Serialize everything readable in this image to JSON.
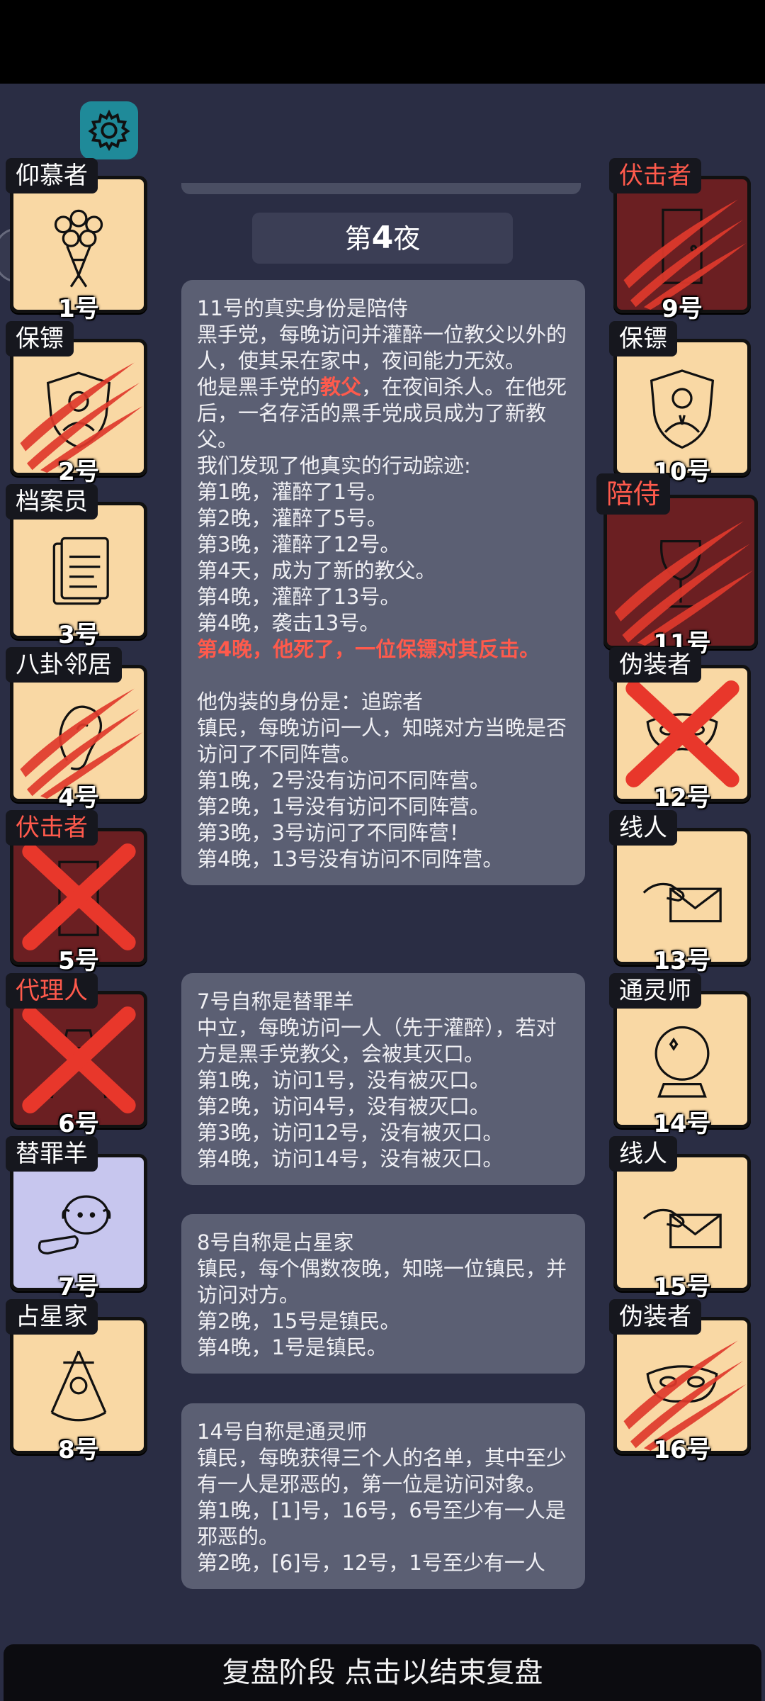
{
  "header": {
    "night_prefix": "第",
    "night_num": "4",
    "night_suffix": "夜"
  },
  "footer": {
    "text": "复盘阶段 点击以结束复盘"
  },
  "left_cards": [
    {
      "role": "仰慕者",
      "num": "1号",
      "state": "alive",
      "icon": "bouquet-icon"
    },
    {
      "role": "保镖",
      "num": "2号",
      "state": "claw",
      "icon": "shield-icon"
    },
    {
      "role": "档案员",
      "num": "3号",
      "state": "alive",
      "icon": "documents-icon"
    },
    {
      "role": "八卦邻居",
      "num": "4号",
      "state": "claw",
      "icon": "ear-icon"
    },
    {
      "role": "伏击者",
      "num": "5号",
      "state": "x",
      "icon": "door-icon",
      "red": true
    },
    {
      "role": "代理人",
      "num": "6号",
      "state": "x",
      "icon": "spy-icon",
      "red": true
    },
    {
      "role": "替罪羊",
      "num": "7号",
      "state": "alive",
      "icon": "sheep-icon"
    },
    {
      "role": "占星家",
      "num": "8号",
      "state": "alive",
      "icon": "sextant-icon"
    }
  ],
  "right_cards": [
    {
      "role": "伏击者",
      "num": "9号",
      "state": "claw",
      "icon": "door-icon",
      "red": true
    },
    {
      "role": "保镖",
      "num": "10号",
      "state": "alive",
      "icon": "bodyguard-icon"
    },
    {
      "role": "陪侍",
      "num": "11号",
      "state": "claw",
      "icon": "wineglass-icon",
      "red": true
    },
    {
      "role": "伪装者",
      "num": "12号",
      "state": "x",
      "icon": "mask-icon"
    },
    {
      "role": "线人",
      "num": "13号",
      "state": "alive",
      "icon": "envelope-icon"
    },
    {
      "role": "通灵师",
      "num": "14号",
      "state": "alive",
      "icon": "crystal-ball-icon"
    },
    {
      "role": "线人",
      "num": "15号",
      "state": "alive",
      "icon": "envelope-icon"
    },
    {
      "role": "伪装者",
      "num": "16号",
      "state": "claw",
      "icon": "mask-icon"
    }
  ],
  "panel1": {
    "l1": "11号的真实身份是陪侍",
    "l2": "黑手党，每晚访问并灌醉一位教父以外的人，使其呆在家中，夜间能力无效。",
    "l3a": "他是黑手党的",
    "l3b": "教父",
    "l3c": "，在夜间杀人。在他死后，一名存活的黑手党成员成为了新教父。",
    "l4": "我们发现了他真实的行动踪迹:",
    "l5": "第1晚，灌醉了1号。",
    "l6": "第2晚，灌醉了5号。",
    "l7": "第3晚，灌醉了12号。",
    "l8": "第4天，成为了新的教父。",
    "l9": "第4晚，灌醉了13号。",
    "l10": "第4晚，袭击13号。",
    "l11": "第4晚，他死了，一位保镖对其反击。",
    "l12": "他伪装的身份是：追踪者",
    "l13": "镇民，每晚访问一人，知晓对方当晚是否访问了不同阵营。",
    "l14": "第1晚，2号没有访问不同阵营。",
    "l15": "第2晚，1号没有访问不同阵营。",
    "l16": "第3晚，3号访问了不同阵营！",
    "l17": "第4晚，13号没有访问不同阵营。"
  },
  "panel2": {
    "l1": "7号自称是替罪羊",
    "l2": "中立，每晚访问一人（先于灌醉），若对方是黑手党教父，会被其灭口。",
    "l3": "第1晚，访问1号，没有被灭口。",
    "l4": "第2晚，访问4号，没有被灭口。",
    "l5": "第3晚，访问12号，没有被灭口。",
    "l6": "第4晚，访问14号，没有被灭口。"
  },
  "panel3": {
    "l1": "8号自称是占星家",
    "l2": "镇民，每个偶数夜晚，知晓一位镇民，并访问对方。",
    "l3": "第2晚，15号是镇民。",
    "l4": "第4晚，1号是镇民。"
  },
  "panel4": {
    "l1": "14号自称是通灵师",
    "l2": "镇民，每晚获得三个人的名单，其中至少有一人是邪恶的，第一位是访问对象。",
    "l3": "第1晚，[1]号，16号，6号至少有一人是邪恶的。",
    "l4": "第2晚，[6]号，12号，1号至少有一人"
  }
}
